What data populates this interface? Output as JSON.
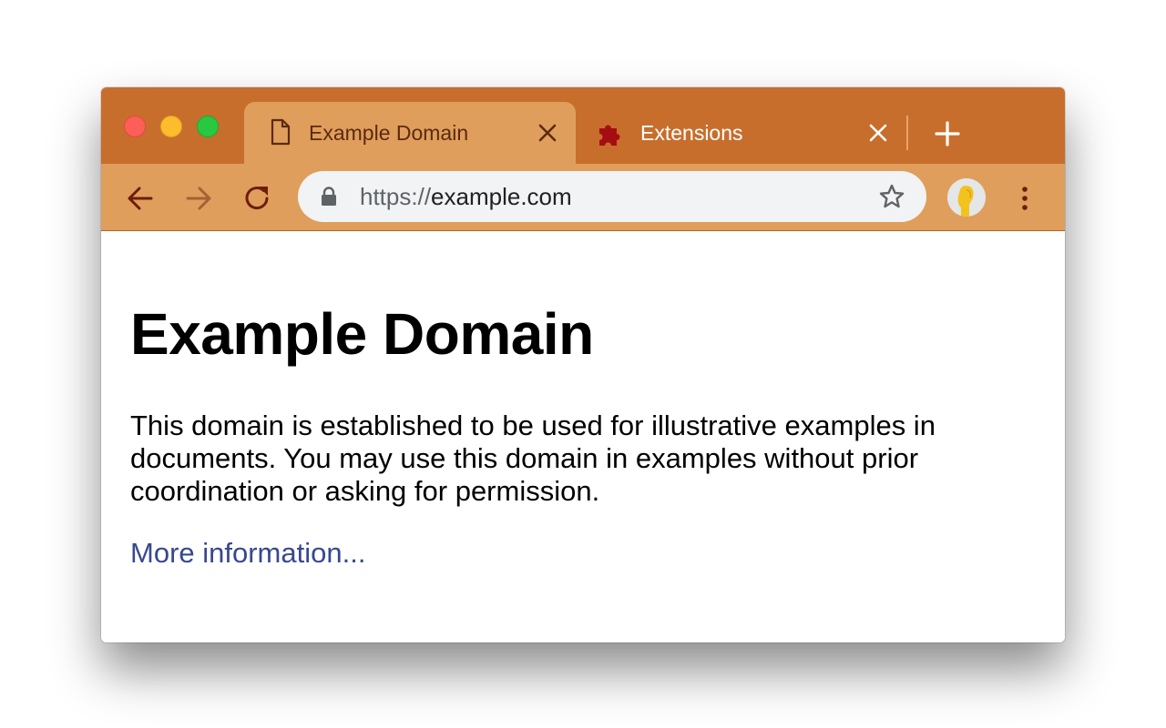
{
  "tabs": [
    {
      "title": "Example Domain",
      "icon": "page-icon",
      "active": true
    },
    {
      "title": "Extensions",
      "icon": "puzzle-icon",
      "active": false
    }
  ],
  "tab_close_glyph": "✕",
  "new_tab_glyph": "+",
  "omnibox": {
    "scheme": "https://",
    "host": "example.com"
  },
  "page": {
    "heading": "Example Domain",
    "body": "This domain is established to be used for illustrative examples in documents. You may use this domain in examples without prior coordination or asking for permission.",
    "link": "More information..."
  },
  "colors": {
    "tabstrip": "#c86e2c",
    "toolbar": "#df9e5c",
    "omnibox": "#f1f3f4",
    "link": "#38488f",
    "active_tab_text": "#5b2a10"
  }
}
